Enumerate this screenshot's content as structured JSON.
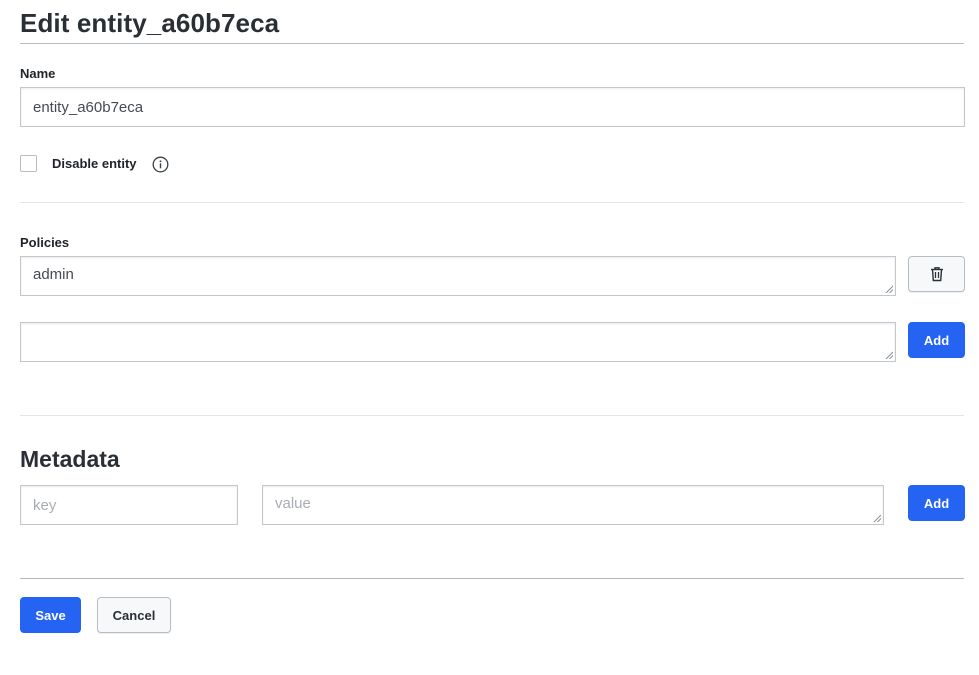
{
  "page": {
    "title": "Edit entity_a60b7eca"
  },
  "name_field": {
    "label": "Name",
    "value": "entity_a60b7eca"
  },
  "disable": {
    "label": "Disable entity",
    "checked": false,
    "info_icon": "info-icon"
  },
  "policies": {
    "label": "Policies",
    "items": [
      "admin"
    ],
    "new_value": "",
    "delete_icon": "trash-icon",
    "add_label": "Add"
  },
  "metadata": {
    "heading": "Metadata",
    "key_placeholder": "key",
    "value_placeholder": "value",
    "add_label": "Add"
  },
  "actions": {
    "save_label": "Save",
    "cancel_label": "Cancel"
  },
  "colors": {
    "primary": "#2563f2",
    "border": "#c2c7ce"
  }
}
